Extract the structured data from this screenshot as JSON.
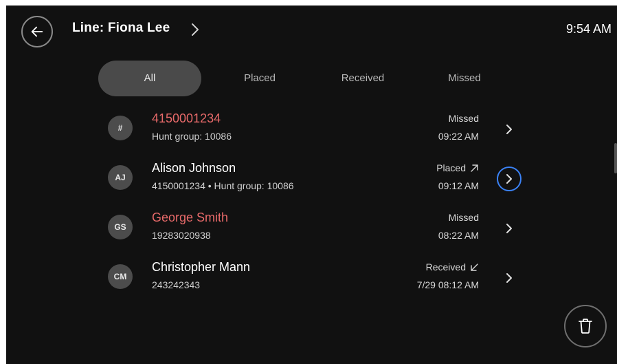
{
  "header": {
    "title": "Line: Fiona Lee",
    "time": "9:54 AM"
  },
  "tabs": [
    {
      "label": "All",
      "active": true
    },
    {
      "label": "Placed",
      "active": false
    },
    {
      "label": "Received",
      "active": false
    },
    {
      "label": "Missed",
      "active": false
    }
  ],
  "calls": [
    {
      "initials": "#",
      "name": "4150001234",
      "detail": "Hunt group: 10086",
      "status": "Missed",
      "time": "09:22 AM",
      "missed": true,
      "direction_icon": ""
    },
    {
      "initials": "AJ",
      "name": "Alison Johnson",
      "detail": "4150001234 • Hunt group: 10086",
      "status": "Placed",
      "time": "09:12 AM",
      "missed": false,
      "direction_icon": "outgoing-arrow-icon"
    },
    {
      "initials": "GS",
      "name": "George Smith",
      "detail": "19283020938",
      "status": "Missed",
      "time": "08:22 AM",
      "missed": true,
      "direction_icon": ""
    },
    {
      "initials": "CM",
      "name": "Christopher Mann",
      "detail": "243242343",
      "status": "Received",
      "time": "7/29 08:12 AM",
      "missed": false,
      "direction_icon": "incoming-arrow-icon"
    }
  ],
  "colors": {
    "background": "#111111",
    "missed_text": "#e86a6a",
    "focus_ring": "#3b82f6",
    "active_tab": "#4a4a4a"
  },
  "icons": {
    "back": "back-arrow-icon",
    "title_chevron": "chevron-right-icon",
    "row_chevron": "chevron-right-icon",
    "delete": "trash-icon"
  }
}
